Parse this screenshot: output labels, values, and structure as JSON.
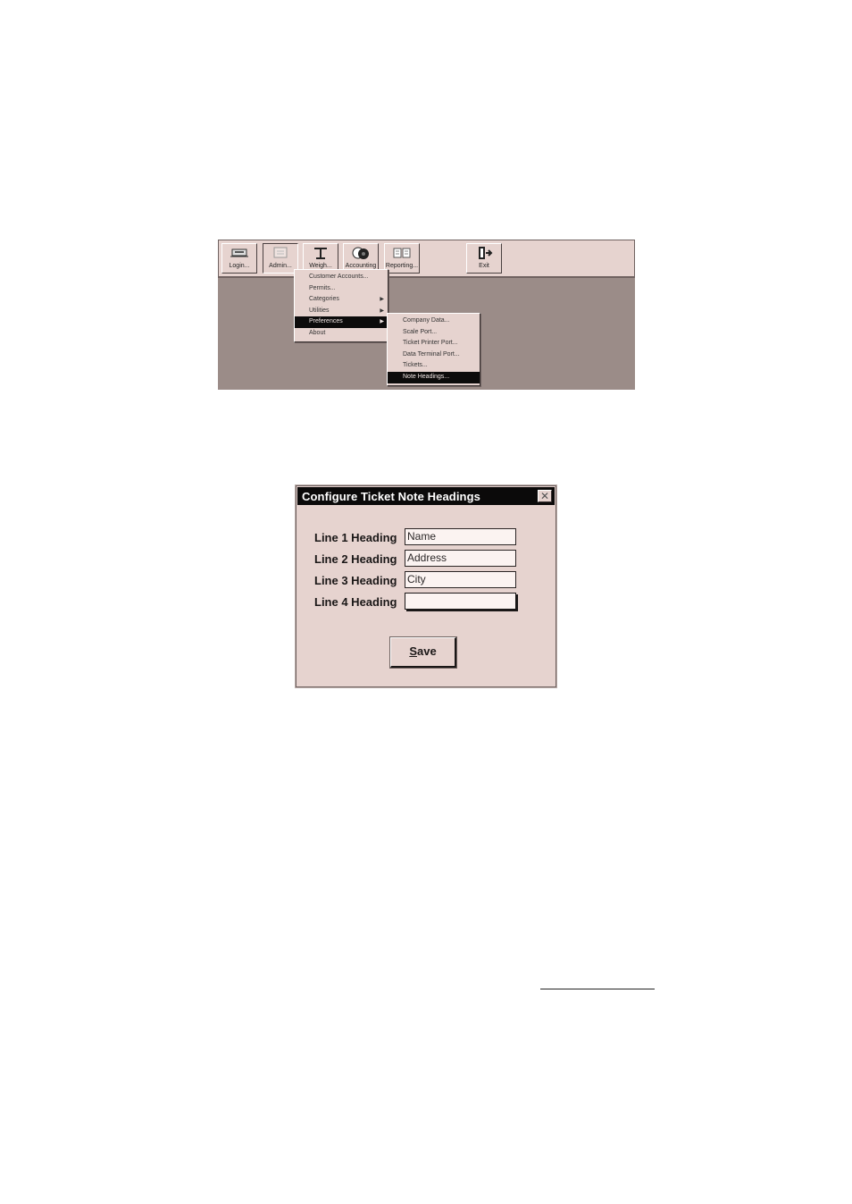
{
  "toolbar": {
    "buttons": [
      {
        "label": "Login...",
        "icon": "login-icon"
      },
      {
        "label": "Admin...",
        "icon": "admin-icon"
      },
      {
        "label": "Weigh...",
        "icon": "scale-icon"
      },
      {
        "label": "Accounting",
        "icon": "accounting-icon"
      },
      {
        "label": "Reporting...",
        "icon": "reporting-icon"
      },
      {
        "label": "Exit",
        "icon": "exit-icon"
      }
    ]
  },
  "admin_menu": {
    "items": [
      {
        "label": "Customer Accounts..."
      },
      {
        "label": "Permits..."
      },
      {
        "label": "Categories",
        "submenu": true
      },
      {
        "label": "Utilities",
        "submenu": true
      },
      {
        "label": "Preferences",
        "submenu": true,
        "selected": true
      },
      {
        "label": "About"
      }
    ]
  },
  "preferences_menu": {
    "items": [
      {
        "label": "Company Data..."
      },
      {
        "label": "Scale Port..."
      },
      {
        "label": "Ticket Printer Port..."
      },
      {
        "label": "Data Terminal Port..."
      },
      {
        "label": "Tickets..."
      },
      {
        "label": "Note Headings...",
        "selected": true
      }
    ]
  },
  "dialog": {
    "title": "Configure Ticket Note Headings",
    "close_glyph": "✕",
    "fields": [
      {
        "label": "Line 1 Heading",
        "value": "Name"
      },
      {
        "label": "Line 2 Heading",
        "value": "Address"
      },
      {
        "label": "Line 3 Heading",
        "value": "City"
      },
      {
        "label": "Line 4 Heading",
        "value": ""
      }
    ],
    "save_label_mnemonic": "S",
    "save_label_rest": "ave"
  }
}
